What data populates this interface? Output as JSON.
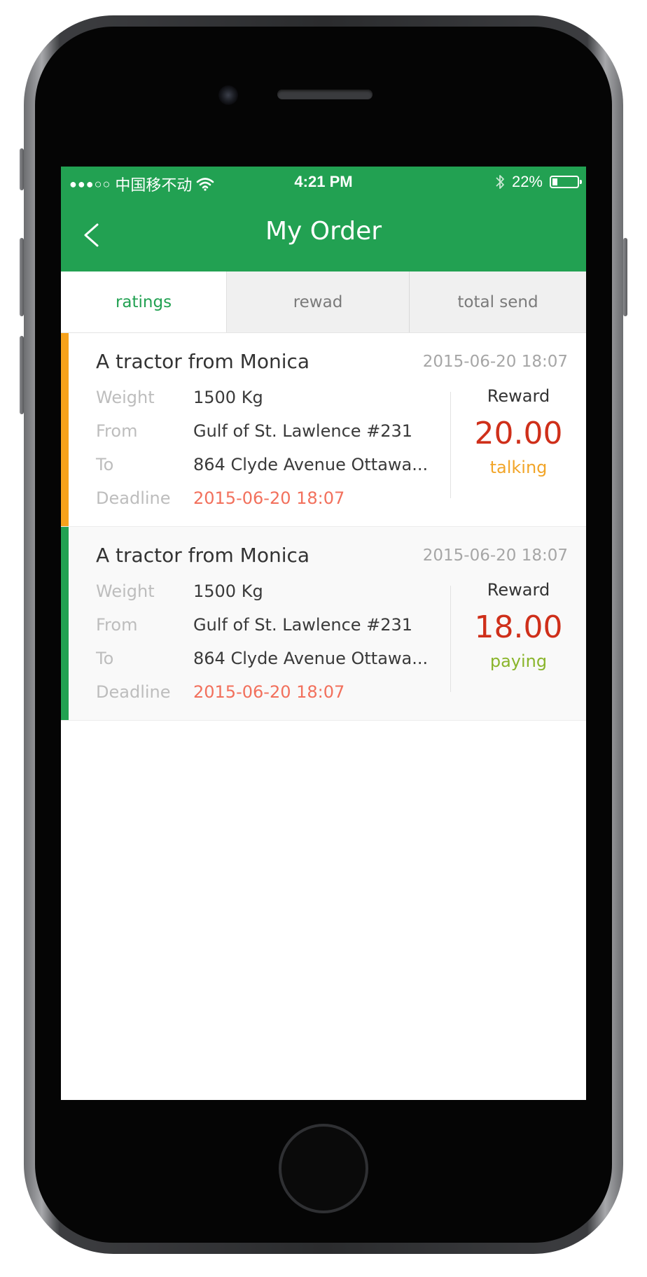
{
  "status_bar": {
    "signal": "●●●○○",
    "carrier": "中国移不动",
    "time": "4:21 PM",
    "battery_text": "22%",
    "battery_level": 0.22
  },
  "header": {
    "title": "My Order"
  },
  "tabs": [
    {
      "label": "ratings",
      "active": true
    },
    {
      "label": "rewad",
      "active": false
    },
    {
      "label": "total send",
      "active": false
    }
  ],
  "labels": {
    "weight": "Weight",
    "from": "From",
    "to": "To",
    "deadline": "Deadline",
    "reward": "Reward"
  },
  "orders": [
    {
      "title": "A tractor from Monica",
      "date": "2015-06-20 18:07",
      "weight": "1500 Kg",
      "from": "Gulf of St. Lawlence #231",
      "to": "864 Clyde Avenue Ottawa...",
      "deadline": "2015-06-20 18:07",
      "reward": "20.00",
      "status": "talking",
      "accent_color": "#f7a21b",
      "status_color": "#f2a528",
      "background": "#ffffff"
    },
    {
      "title": "A tractor from Monica",
      "date": "2015-06-20 18:07",
      "weight": "1500 Kg",
      "from": "Gulf of St. Lawlence #231",
      "to": "864 Clyde Avenue Ottawa...",
      "deadline": "2015-06-20 18:07",
      "reward": "18.00",
      "status": "paying",
      "accent_color": "#22a152",
      "status_color": "#8ab52c",
      "background": "#f9f9f9"
    }
  ],
  "colors": {
    "brand_green": "#22a152",
    "reward_red": "#cf2f1a",
    "deadline_red": "#f2705c"
  }
}
